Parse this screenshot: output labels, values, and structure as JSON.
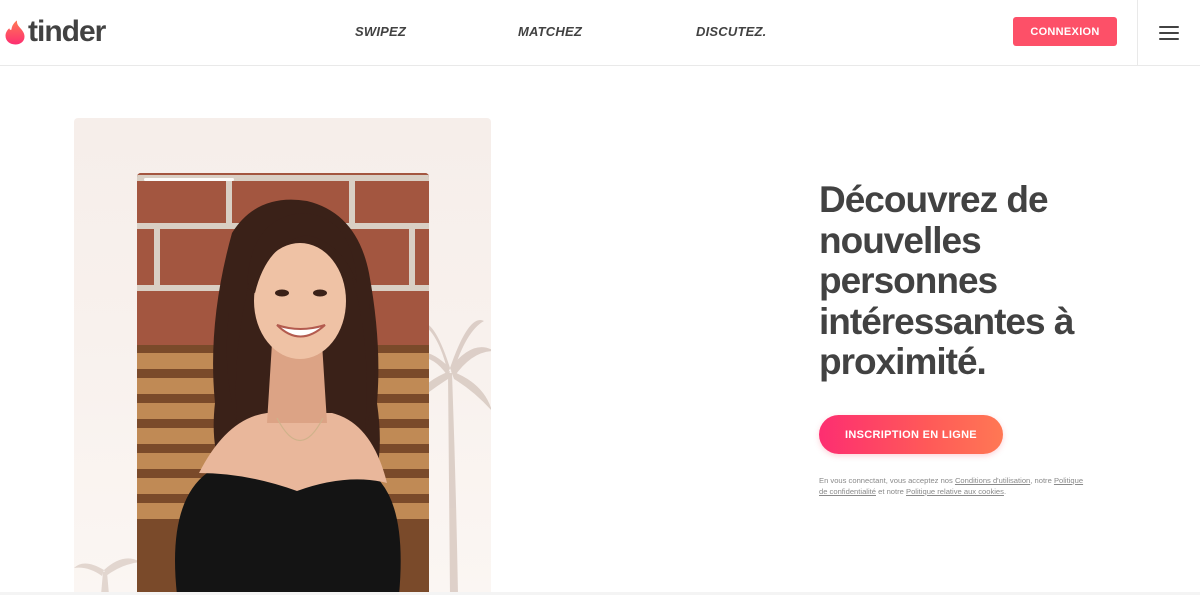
{
  "brand": {
    "name": "tinder",
    "accent_color": "#fd5068",
    "gradient_start": "#fd2e71",
    "gradient_end": "#ff7854",
    "text_color": "#424242"
  },
  "nav": {
    "items": [
      {
        "label": "SWIPEZ"
      },
      {
        "label": "MATCHEZ"
      },
      {
        "label": "DISCUTEZ."
      }
    ],
    "login_label": "CONNEXION",
    "menu_icon": "hamburger-menu-icon"
  },
  "hero": {
    "headline": "Découvrez de nouvelles personnes intéressantes à proximité.",
    "signup_label": "INSCRIPTION EN LIGNE",
    "legal": {
      "prefix": "En vous connectant, vous acceptez nos",
      "terms_link": "Conditions d'utilisation",
      "middle": ", notre",
      "privacy_link": "Politique de confidentialité",
      "and": "et notre",
      "cookies_link": "Politique relative aux cookies",
      "suffix": "."
    }
  }
}
